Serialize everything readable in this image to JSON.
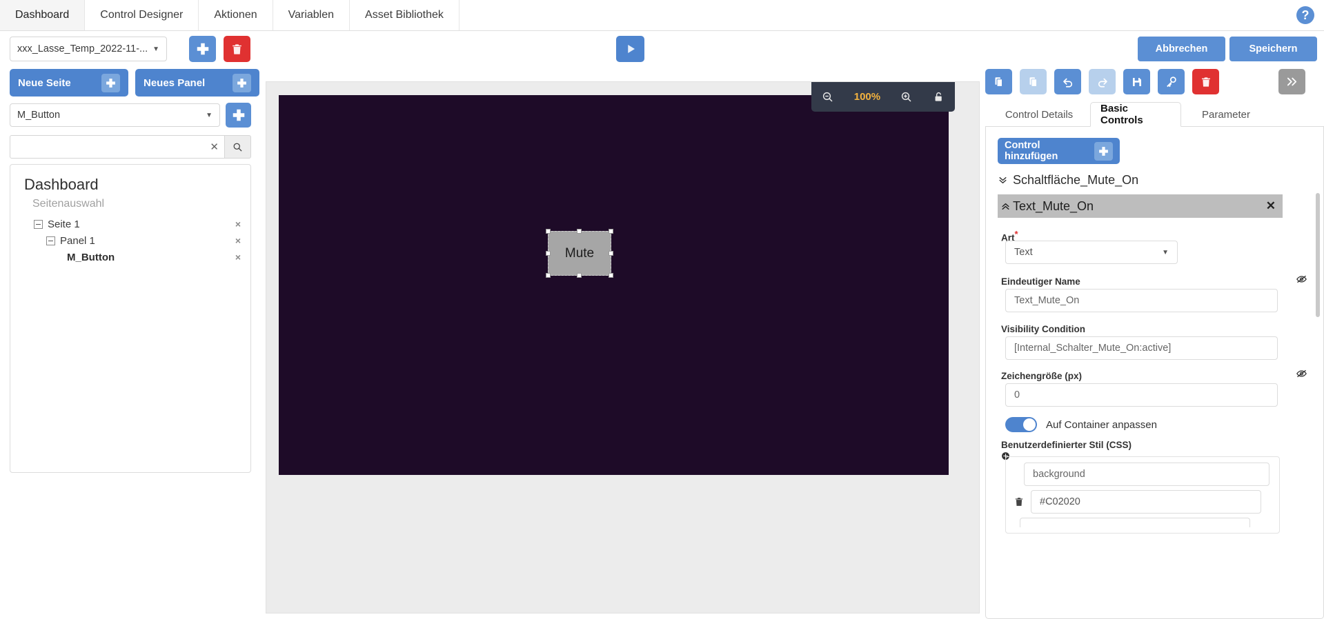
{
  "topnav": {
    "tabs": [
      {
        "label": "Dashboard",
        "active": true
      },
      {
        "label": "Control Designer",
        "active": false
      },
      {
        "label": "Aktionen",
        "active": false
      },
      {
        "label": "Variablen",
        "active": false
      },
      {
        "label": "Asset Bibliothek",
        "active": false
      }
    ],
    "help_label": "?"
  },
  "subbar": {
    "project_value": "xxx_Lasse_Temp_2022-11-...",
    "add_icon": "plus-icon",
    "delete_icon": "trash-icon",
    "play_icon": "play-icon",
    "cancel_label": "Abbrechen",
    "save_label": "Speichern"
  },
  "sidebar": {
    "new_page_label": "Neue Seite",
    "new_panel_label": "Neues Panel",
    "control_select_value": "M_Button",
    "search_value": "",
    "search_placeholder": "",
    "tree": {
      "title": "Dashboard",
      "subtitle": "Seitenauswahl",
      "nodes": [
        {
          "label": "Seite 1",
          "level": 1,
          "expander": true,
          "close": "×"
        },
        {
          "label": "Panel 1",
          "level": 2,
          "expander": true,
          "close": "×"
        },
        {
          "label": "M_Button",
          "level": 3,
          "expander": false,
          "close": "×"
        }
      ]
    }
  },
  "canvas": {
    "background_color": "#1e0b28",
    "zoom": {
      "zoom_out_icon": "zoom-out-icon",
      "level": "100%",
      "zoom_in_icon": "zoom-in-icon",
      "lock_icon": "lock-icon"
    },
    "control": {
      "label": "Mute",
      "selected": true
    }
  },
  "right_panel": {
    "toolbar": [
      {
        "name": "copy-button",
        "style": "blue"
      },
      {
        "name": "paste-button",
        "style": "lightblue"
      },
      {
        "name": "undo-button",
        "style": "blue"
      },
      {
        "name": "redo-button",
        "style": "lightblue"
      },
      {
        "name": "save-button",
        "style": "blue"
      },
      {
        "name": "key-button",
        "style": "blue"
      },
      {
        "name": "delete-button",
        "style": "red"
      },
      {
        "name": "expand-button",
        "style": "grey"
      }
    ],
    "tabs": [
      {
        "label": "Control Details",
        "active": false
      },
      {
        "label": "Basic Controls",
        "active": true
      },
      {
        "label": "Parameter",
        "active": false
      }
    ],
    "add_control_label": "Control hinzufügen",
    "group_collapsed_label": "Schaltfläche_Mute_On",
    "group_selected_label": "Text_Mute_On",
    "group_selected_close": "✕",
    "fields": {
      "art_label": "Art",
      "art_required": "*",
      "art_value": "Text",
      "name_label": "Eindeutiger Name",
      "name_value": "Text_Mute_On",
      "visibility_label": "Visibility Condition",
      "visibility_value": "[Internal_Schalter_Mute_On:active]",
      "fontsize_label": "Zeichengröße (px)",
      "fontsize_value": "0",
      "fit_container_label": "Auf Container anpassen",
      "fit_container_on": true,
      "css_label": "Benutzerdefinierter Stil (CSS)",
      "css_key": "background",
      "css_value": "#C02020"
    }
  },
  "colors": {
    "accent_blue": "#4e84ce",
    "light_blue": "#b7d0ec",
    "danger_red": "#e03131",
    "canvas_purple": "#1e0b28",
    "zoom_bar_dark": "#333a49",
    "zoom_level_amber": "#f3b23f",
    "selected_row_grey": "#bdbdbd"
  }
}
